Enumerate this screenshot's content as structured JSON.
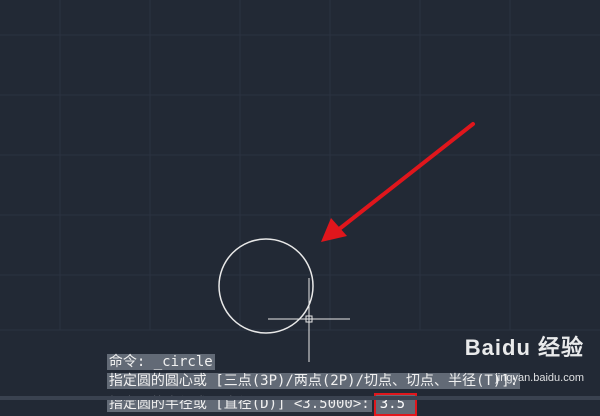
{
  "command_history": {
    "line1": "命令: _circle",
    "line2": "指定圆的圆心或 [三点(3P)/两点(2P)/切点、切点、半径(T)]:",
    "line3_prompt": "指定圆的半径或 [直径(D)] <3.5000>:",
    "input_value": "3.5"
  },
  "watermark": {
    "brand": "Baidu 经验",
    "sub": "jingyan.baidu.com"
  },
  "colors": {
    "background": "#222935",
    "arrow": "#e0161c",
    "highlight_box": "#e0161c",
    "circle": "#ffffff"
  },
  "drawing": {
    "circle_radius": "3.5"
  }
}
